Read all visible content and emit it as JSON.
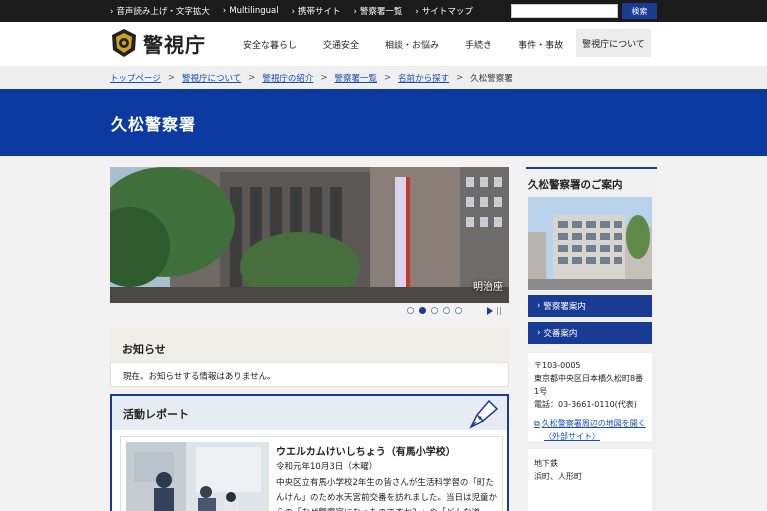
{
  "topbar": {
    "links": [
      "音声読み上げ・文字拡大",
      "Multilingual",
      "携帯サイト",
      "警察署一覧",
      "サイトマップ"
    ],
    "search_placeholder": "",
    "search_button": "検索"
  },
  "header": {
    "logo_text": "警視庁",
    "nav": [
      "安全な暮らし",
      "交通安全",
      "相談・お悩み",
      "手続き",
      "事件・事故",
      "警視庁について"
    ],
    "active_nav": "警視庁について"
  },
  "breadcrumb": {
    "links": [
      "トップページ",
      "警視庁について",
      "警視庁の紹介",
      "警察署一覧",
      "名前から探す"
    ],
    "current": "久松警察署"
  },
  "page_title": "久松警察署",
  "slider": {
    "caption": "明治座",
    "dot_count": 5,
    "active_dot": 2
  },
  "notice": {
    "title": "お知らせ",
    "body": "現在、お知らせする情報はありません。"
  },
  "report": {
    "title": "活動レポート",
    "item_title": "ウエルカムけいしちょう（有馬小学校）",
    "item_date": "令和元年10月3日（木曜）",
    "item_text": "中央区立有馬小学校2年生の皆さんが生活科学習の「町たんけん」のため水天宮前交番を訪れました。当日は児童からの「なぜ警察官になったのですか？」や「どんな道"
  },
  "side": {
    "title": "久松警察署のご案内",
    "buttons": [
      "警察署案内",
      "交番案内"
    ],
    "postal": "〒103-0005",
    "address": "東京都中央区日本橋久松町8番1号",
    "phone": "電話：03-3661-0110(代表)",
    "map_link": "久松警察署周辺の地図を開く（外部サイト）",
    "access_label": "地下鉄",
    "access_stations": "浜町、人形町"
  },
  "colors": {
    "brand_blue": "#0d3aa0",
    "button_blue": "#1a3b93",
    "topbar_black": "#1b1b1b"
  }
}
